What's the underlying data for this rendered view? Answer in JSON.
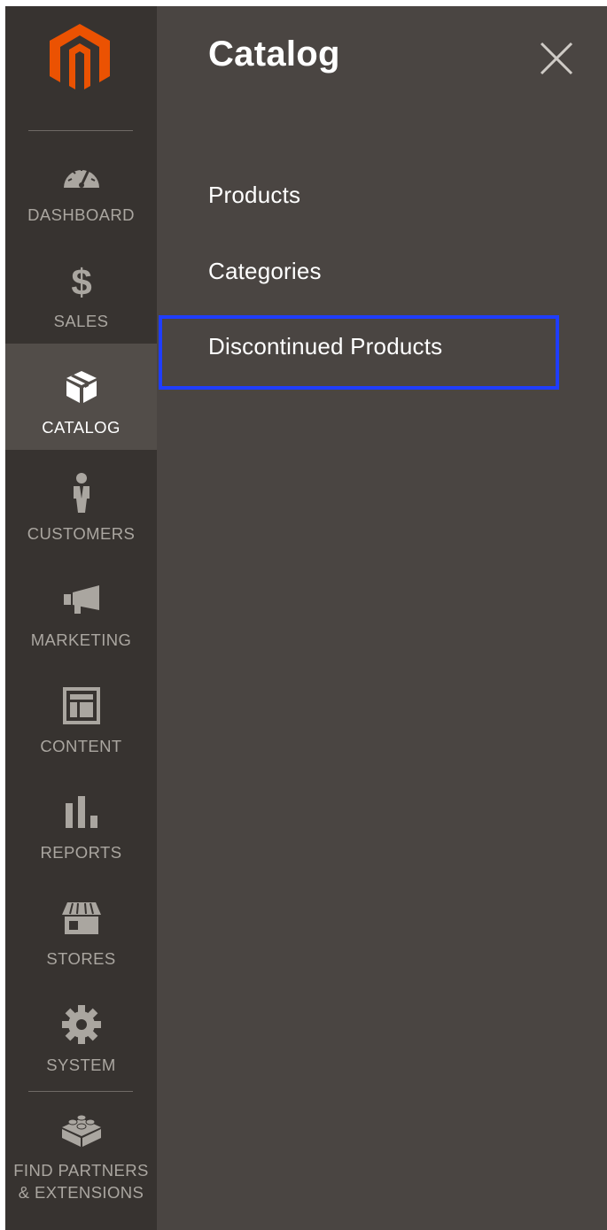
{
  "app": {
    "brand_color": "#eb5202"
  },
  "sidebar": {
    "items": [
      {
        "id": "dashboard",
        "label": "DASHBOARD",
        "icon": "dashboard-gauge-icon"
      },
      {
        "id": "sales",
        "label": "SALES",
        "icon": "dollar-icon"
      },
      {
        "id": "catalog",
        "label": "CATALOG",
        "icon": "box-icon",
        "active": true
      },
      {
        "id": "customers",
        "label": "CUSTOMERS",
        "icon": "person-icon"
      },
      {
        "id": "marketing",
        "label": "MARKETING",
        "icon": "megaphone-icon"
      },
      {
        "id": "content",
        "label": "CONTENT",
        "icon": "layout-icon"
      },
      {
        "id": "reports",
        "label": "REPORTS",
        "icon": "bar-chart-icon"
      },
      {
        "id": "stores",
        "label": "STORES",
        "icon": "storefront-icon"
      },
      {
        "id": "system",
        "label": "SYSTEM",
        "icon": "gear-icon"
      },
      {
        "id": "partners",
        "label_line1": "FIND PARTNERS",
        "label_line2": "& EXTENSIONS",
        "icon": "lego-brick-icon"
      }
    ]
  },
  "panel": {
    "title": "Catalog",
    "close_icon": "close-icon",
    "links": [
      {
        "label": "Products"
      },
      {
        "label": "Categories"
      },
      {
        "label": "Discontinued Products",
        "highlighted": true
      }
    ],
    "highlight_color": "#1f3dff"
  }
}
